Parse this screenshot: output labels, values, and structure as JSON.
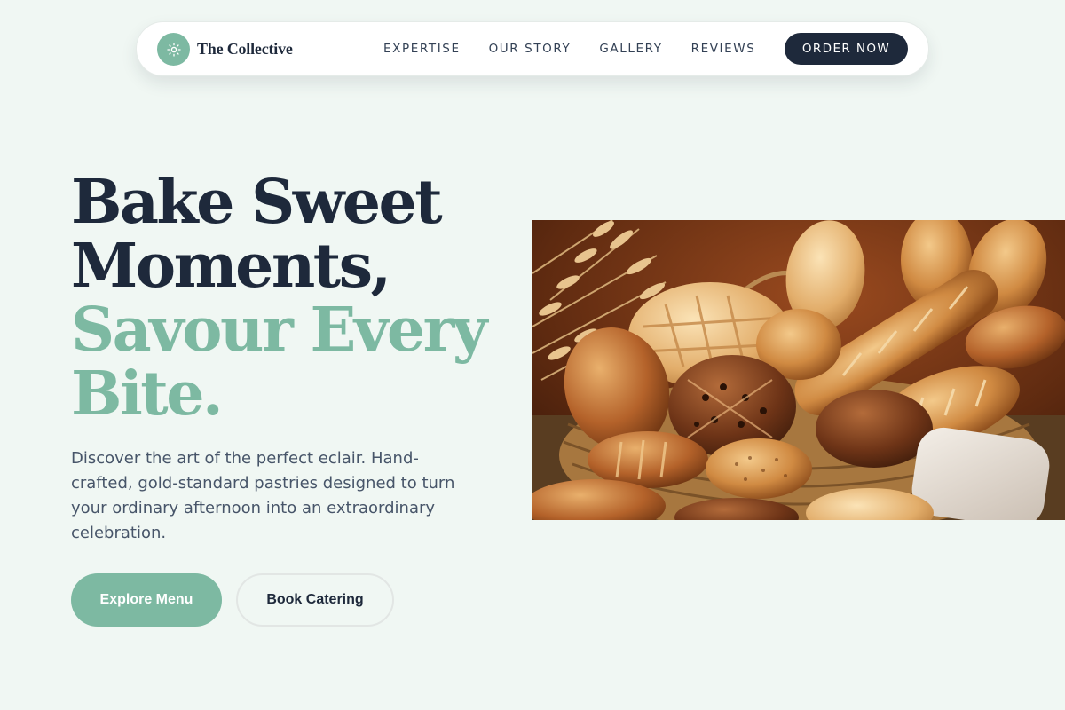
{
  "brand": {
    "name": "The Collective",
    "logo_icon": "sun-icon",
    "accent_color": "#7db9a2",
    "dark_color": "#1e293b"
  },
  "nav": {
    "links": [
      {
        "label": "EXPERTISE"
      },
      {
        "label": "OUR STORY"
      },
      {
        "label": "GALLERY"
      },
      {
        "label": "REVIEWS"
      }
    ],
    "cta_label": "ORDER NOW"
  },
  "hero": {
    "headline_line1": "Bake Sweet",
    "headline_line2": "Moments,",
    "headline_accent_line1": "Savour Every",
    "headline_accent_line2": "Bite.",
    "description": "Discover the art of the perfect eclair. Hand-crafted, gold-standard pastries designed to turn your ordinary afternoon into an extraordinary celebration.",
    "primary_button": "Explore Menu",
    "secondary_button": "Book Catering"
  }
}
